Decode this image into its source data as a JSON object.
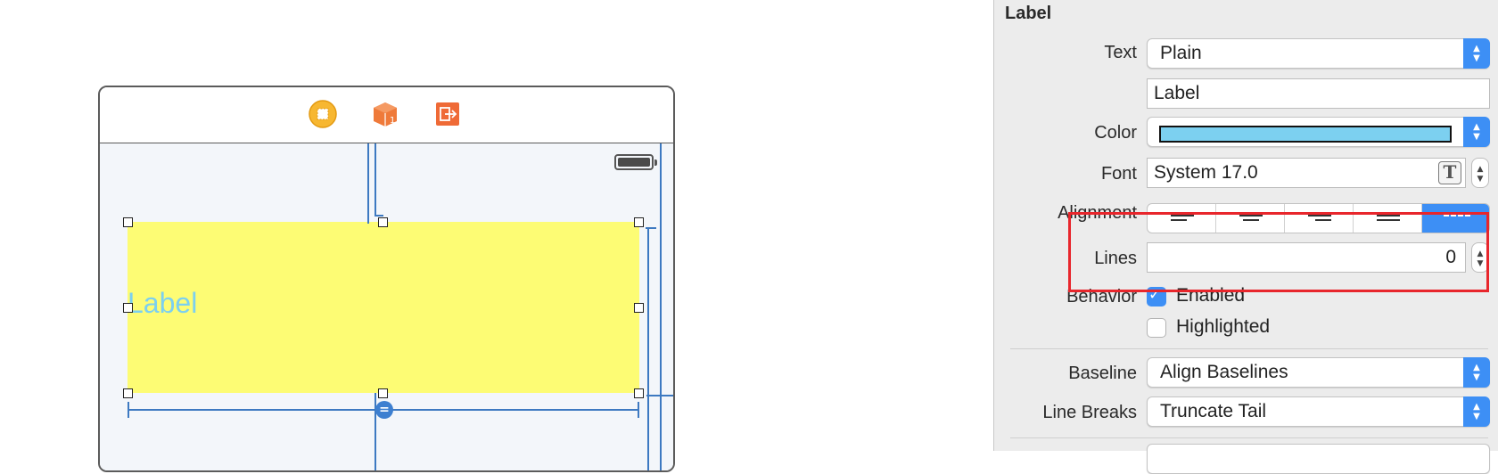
{
  "canvas": {
    "label_text": "Label",
    "label_background": "#fdfc74",
    "label_text_color": "#7cd0f0",
    "dock_icons": [
      "view-controller-icon",
      "first-responder-icon",
      "exit-icon"
    ]
  },
  "inspector": {
    "section_title": "Label",
    "text": {
      "label": "Text",
      "value": "Plain"
    },
    "text_content": "Label",
    "color": {
      "label": "Color",
      "value": "#7cd0f0"
    },
    "font": {
      "label": "Font",
      "value": "System 17.0"
    },
    "alignment": {
      "label": "Alignment",
      "options": [
        "left",
        "center",
        "right",
        "justified",
        "natural"
      ],
      "selected": "natural"
    },
    "lines": {
      "label": "Lines",
      "value": "0"
    },
    "behavior": {
      "label": "Behavior",
      "enabled": {
        "label": "Enabled",
        "checked": true
      },
      "highlighted": {
        "label": "Highlighted",
        "checked": false
      }
    },
    "baseline": {
      "label": "Baseline",
      "value": "Align Baselines"
    },
    "line_breaks": {
      "label": "Line Breaks",
      "value": "Truncate Tail"
    }
  },
  "accent_color": "#3d8ff5",
  "highlight_color": "#e8262c"
}
